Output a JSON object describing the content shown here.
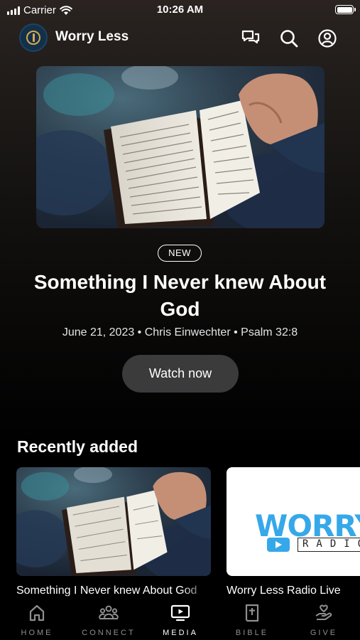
{
  "status_bar": {
    "carrier": "Carrier",
    "time": "10:26 AM",
    "icons": [
      "signal-icon",
      "wifi-icon",
      "battery-icon"
    ]
  },
  "header": {
    "app_title": "Worry Less",
    "icons": [
      "chat-icon",
      "search-icon",
      "account-icon"
    ]
  },
  "hero": {
    "badge": "NEW",
    "title": "Something I Never knew About God",
    "meta": "June 21, 2023 • Chris Einwechter • Psalm 32:8",
    "button_label": "Watch now"
  },
  "recently_added": {
    "title": "Recently added",
    "items": [
      {
        "caption": "Something I Never knew About God"
      },
      {
        "caption": "Worry Less Radio Live",
        "logo_text": "WORRYLESS",
        "logo_subtext": "RADIO"
      }
    ]
  },
  "tab_bar": {
    "tabs": [
      {
        "label": "HOME",
        "icon": "home-icon"
      },
      {
        "label": "CONNECT",
        "icon": "connect-icon"
      },
      {
        "label": "MEDIA",
        "icon": "media-icon",
        "active": true
      },
      {
        "label": "BIBLE",
        "icon": "bible-icon"
      },
      {
        "label": "GIVE",
        "icon": "give-icon"
      }
    ]
  },
  "colors": {
    "background": "#000000",
    "button_bg": "#3b3b3b",
    "radio_blue": "#36a8ea",
    "inactive_tab": "#8f8f8f"
  }
}
